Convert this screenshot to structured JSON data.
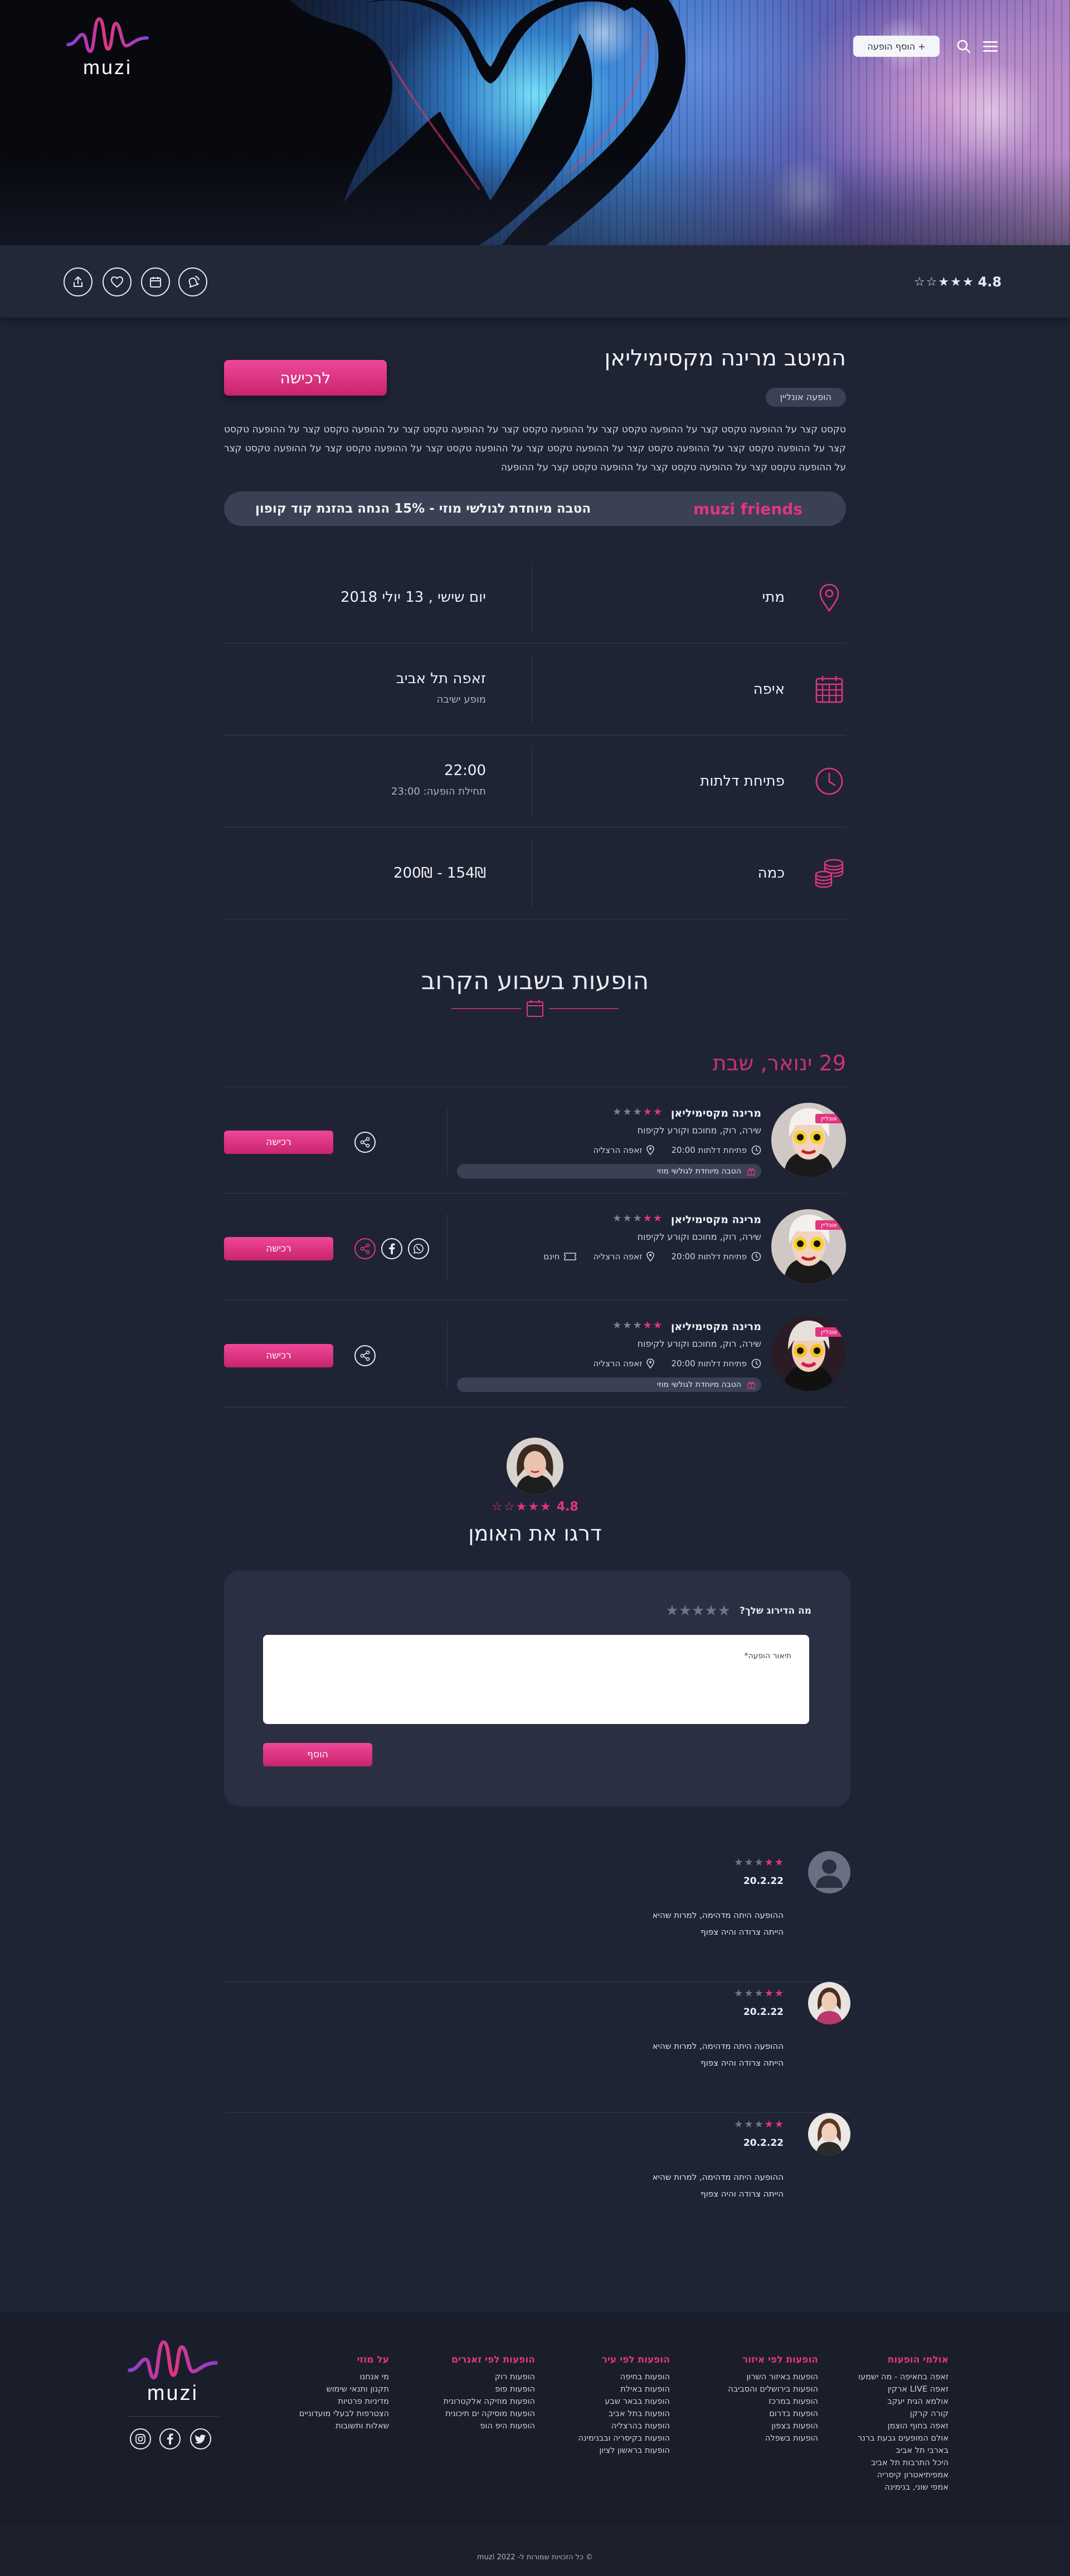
{
  "header": {
    "logo_text": "muzi",
    "add_show_button": "+ הוסף הופעה"
  },
  "event": {
    "rating": "4.8",
    "title": "המיטב מרינה מקסימיליאן",
    "type_badge": "הופעה אונליין",
    "buy_label": "לרכישה",
    "description": "טקסט קצר על ההופעה טקסט קצר על ההופעה טקסט קצר על ההופעה טקסט קצר על ההופעה טקסט קצר על ההופעה טקסט קצר על ההופעה טקסט קצר על ההופעה טקסט קצר על ההופעה טקסט קצר על ההופעה טקסט קצר על ההופעה טקסט קצר על ההופעה טקסט קצר על ההופעה טקסט קצר על ההופעה טקסט קצר על ההופעה טקסט קצר על ההופעה טקסט קצר על ההופעה",
    "promo_brand": "muzi friends",
    "promo_text": "הטבה מיוחדת לגולשי מוזי - 15% הנחה בהזנת קוד קופון"
  },
  "details": {
    "when_label": "מתי",
    "when_value": "יום שישי , 13 יולי 2018",
    "where_label": "איפה",
    "where_value": "זאפה תל אביב",
    "where_sub": "מופע ישיבה",
    "doors_label": "פתיחת דלתות",
    "doors_value": "22:00",
    "doors_sub": "תחילת הופעה: 23:00",
    "price_label": "כמה",
    "price_value": "154₪ - 200₪"
  },
  "upcoming": {
    "title": "הופעות בשבוע הקרוב",
    "date_heading": "29 ינואר, שבת",
    "items": [
      {
        "tag": "אונליין",
        "name": "מרינה מקסימיליאן",
        "genres": "שירה, רוק, מחוכם וקורע לקיפוח",
        "doors": "פתיחת דלתות 20:00",
        "venue": "זאפה הרצליה",
        "extra": "",
        "promo": "הטבה מיוחדת לגולשי מוזי",
        "buy": "רכישה"
      },
      {
        "tag": "אונליין",
        "name": "מרינה מקסימיליאן",
        "genres": "שירה, רוק, מחוכם וקורע לקיפוח",
        "doors": "פתיחת דלתות 20:00",
        "venue": "זאפה הרצליה",
        "extra": "חינם",
        "promo": "",
        "buy": "רכישה"
      },
      {
        "tag": "אונליין",
        "name": "מרינה מקסימיליאן",
        "genres": "שירה, רוק, מחוכם וקורע לקיפוח",
        "doors": "פתיחת דלתות 20:00",
        "venue": "זאפה הרצליה",
        "extra": "",
        "promo": "הטבה מיוחדת לגולשי מוזי",
        "buy": "רכישה"
      }
    ]
  },
  "artist": {
    "rating": "4.8",
    "rate_title": "דרגו את האומן"
  },
  "review_form": {
    "question": "מה הדירוג שלך?",
    "placeholder": "תיאור הופעה*",
    "add_button": "הוסף"
  },
  "reviews": [
    {
      "date": "20.2.22",
      "line1": "ההופעה היתה מדהימה, למרות שהיא",
      "line2": "הייתה צרודה והיה צפוף",
      "stars": 2
    },
    {
      "date": "20.2.22",
      "line1": "ההופעה היתה מדהימה, למרות שהיא",
      "line2": "הייתה צרודה והיה צפוף",
      "stars": 2
    },
    {
      "date": "20.2.22",
      "line1": "ההופעה היתה מדהימה, למרות שהיא",
      "line2": "הייתה צרודה והיה צפוף",
      "stars": 2
    }
  ],
  "footer": {
    "logo_text": "muzi",
    "col_venues": {
      "title": "אולמי הופעות",
      "items": [
        "זאפה בחאיפה - מה ישמעו",
        "זאפה LIVE ארקין",
        "אולמא הגית יעקב",
        "קורה קרקן",
        "זאפה בחוף הוצמן",
        "אולם המופעים גבעת ברנר",
        "בארבי תל אביב",
        "היכל התרבות תל אביב",
        "אמפיתיאטרון קיסריה",
        "אמפי שוני, בנימינה"
      ]
    },
    "col_area": {
      "title": "הופעות לפי איזור",
      "items": [
        "הופעות באיזור השרון",
        "הופעות בירושלים והסביבה",
        "הופעות במרכז",
        "הופעות בדרום",
        "הופעות בצפון",
        "הופעות בשפלה"
      ]
    },
    "col_city": {
      "title": "הופעות לפי עיר",
      "items": [
        "הופעות בחיפה",
        "הופעות באילת",
        "הופעות בבאר שבע",
        "הופעות בתל אביב",
        "הופעות בהרצליה",
        "הופעות בקיסריה ובבנימינה",
        "הופעות בראשון לציון"
      ]
    },
    "col_genre": {
      "title": "הופעות לפי זאנרים",
      "items": [
        "הופעות רוק",
        "הופעות פופ",
        "הופעות מוזיקה אלקטרונית",
        "הופעות מוסיקה ים תיכונית",
        "הופעות היפ הופ"
      ]
    },
    "col_about": {
      "title": "על מוזי",
      "items": [
        "מי אנחנו",
        "תקנון ותנאי שימוש",
        "מדיניות פרטיות",
        "הצטרפות לבעלי מועדוניים",
        "שאלות ותשובות"
      ]
    },
    "copyright": "© כל הזכויות שמורות ל- muzi 2022"
  },
  "colors": {
    "accent": "#e2357f",
    "background": "#1f2434",
    "footer": "#1a1e2b"
  }
}
